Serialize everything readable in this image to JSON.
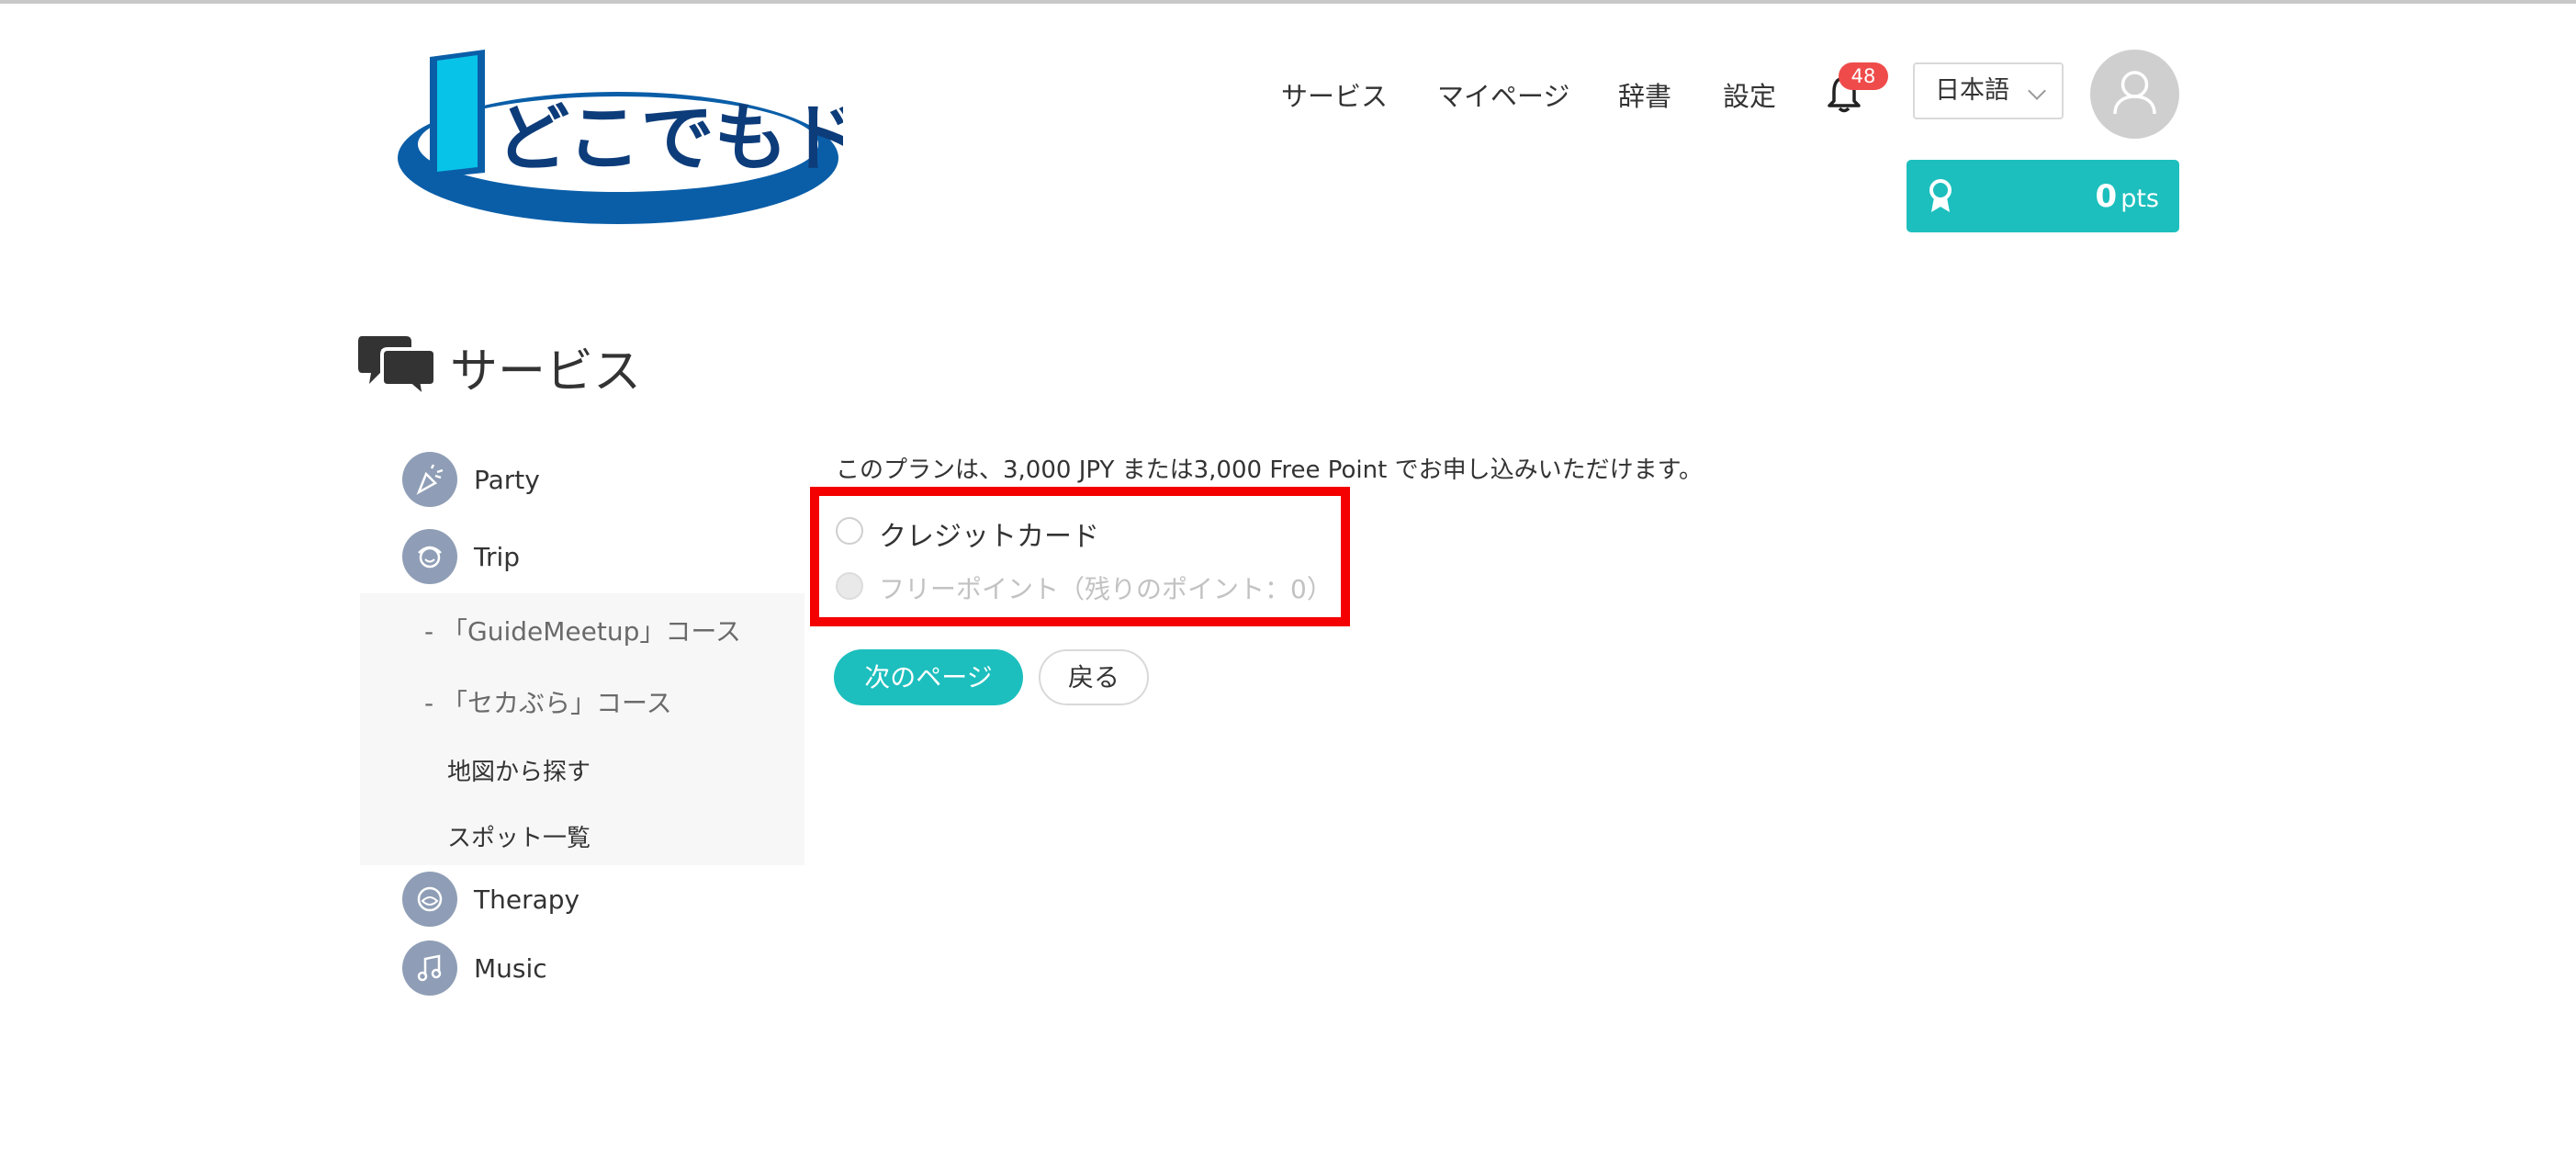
{
  "header": {
    "logo_text": "どこでもドア",
    "nav": [
      {
        "label": "サービス"
      },
      {
        "label": "マイページ"
      },
      {
        "label": "辞書"
      },
      {
        "label": "設定"
      }
    ],
    "notification_count": "48",
    "language": "日本語",
    "points": {
      "value": "0",
      "unit": "pts"
    }
  },
  "page_title": "サービス",
  "sidebar": {
    "items": [
      {
        "label": "Party",
        "icon": "party-popper-icon"
      },
      {
        "label": "Trip",
        "icon": "trip-person-icon"
      },
      {
        "label": "Therapy",
        "icon": "therapy-icon"
      },
      {
        "label": "Music",
        "icon": "music-note-icon"
      }
    ],
    "trip_courses": [
      {
        "label": "- 「GuideMeetup」コース"
      },
      {
        "label": "- 「セカぶら」コース"
      }
    ],
    "trip_links": [
      {
        "label": "地図から探す"
      },
      {
        "label": "スポット一覧"
      }
    ]
  },
  "main": {
    "plan_text": "このプランは、3,000 JPY または3,000 Free Point でお申し込みいただけます。",
    "payment_options": [
      {
        "label": "クレジットカード",
        "selected": false,
        "disabled": false
      },
      {
        "label": "フリーポイント（残りのポイント：0）",
        "selected": false,
        "disabled": true
      }
    ],
    "next_button": "次のページ",
    "back_button": "戻る"
  },
  "colors": {
    "accent": "#1cbfbd",
    "highlight_box": "#f40000",
    "badge": "#ef4b4b",
    "sidebar_icon_bg": "#8f9eb6",
    "logo_blue": "#0a5ea8",
    "logo_cyan": "#08c3e8"
  }
}
